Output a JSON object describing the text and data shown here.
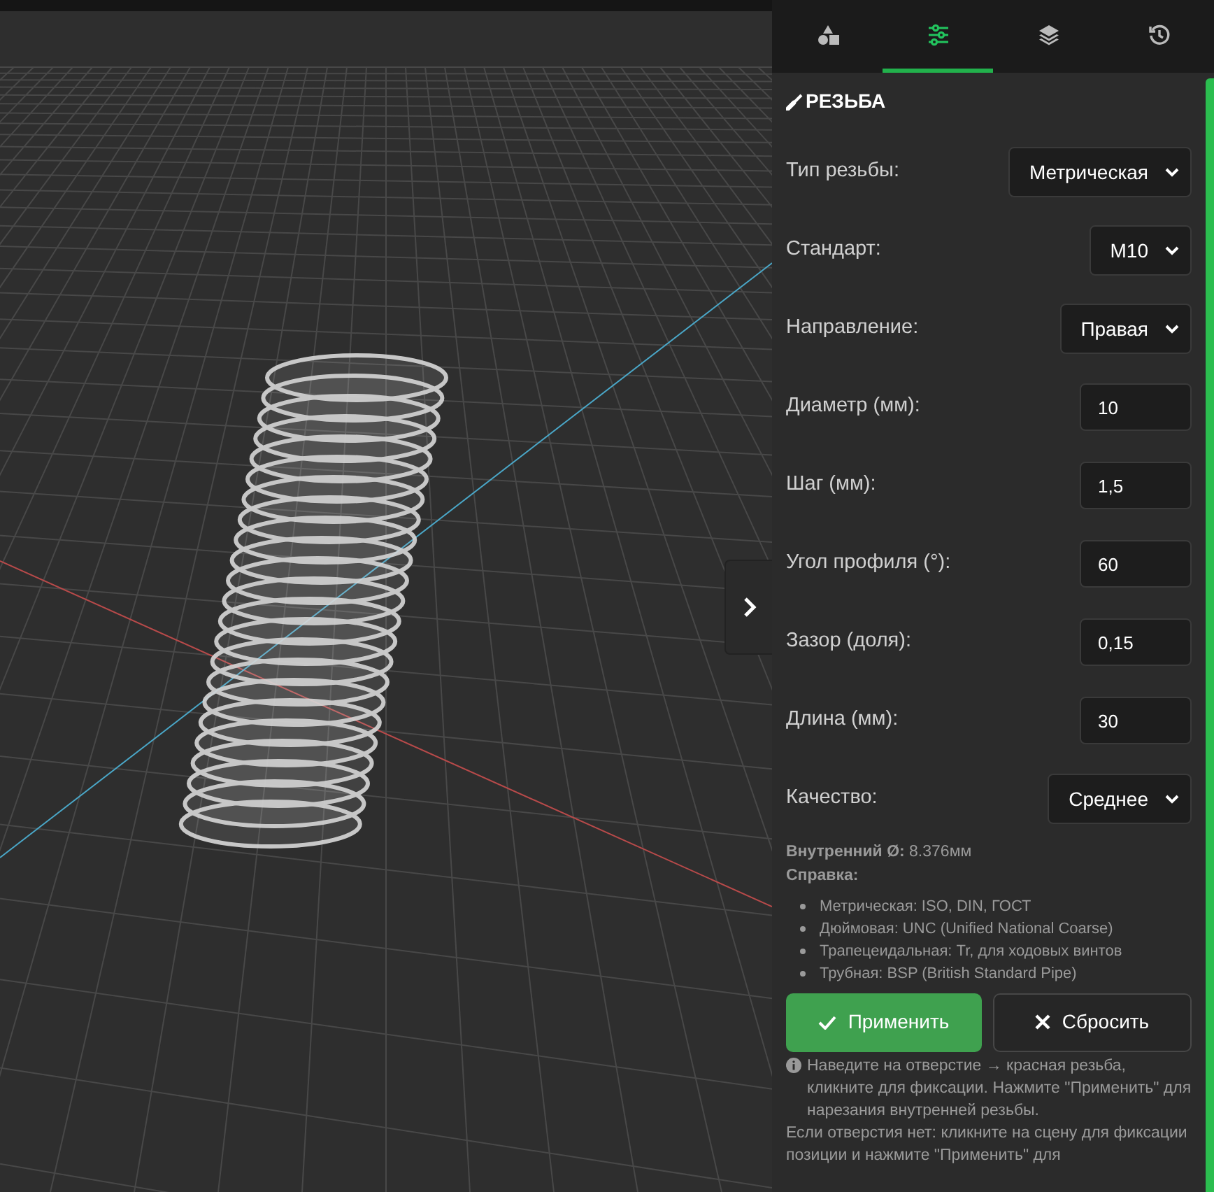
{
  "tabs": [
    {
      "kind": "shapes",
      "selected": false
    },
    {
      "kind": "sliders",
      "selected": true
    },
    {
      "kind": "layers",
      "selected": false
    },
    {
      "kind": "history",
      "selected": false
    }
  ],
  "section_title": "РЕЗЬБА",
  "fields": [
    {
      "label": "Тип резьбы:",
      "kind": "select",
      "value": "Метрическая"
    },
    {
      "label": "Стандарт:",
      "kind": "select",
      "value": "M10"
    },
    {
      "label": "Направление:",
      "kind": "select",
      "value": "Правая"
    },
    {
      "label": "Диаметр (мм):",
      "kind": "input",
      "value": "10"
    },
    {
      "label": "Шаг (мм):",
      "kind": "input",
      "value": "1,5"
    },
    {
      "label": "Угол профиля (°):",
      "kind": "input",
      "value": "60"
    },
    {
      "label": "Зазор (доля):",
      "kind": "input",
      "value": "0,15"
    },
    {
      "label": "Длина (мм):",
      "kind": "input",
      "value": "30"
    },
    {
      "label": "Качество:",
      "kind": "select",
      "value": "Среднее"
    }
  ],
  "inner_diameter": "**Внутренний Ø:** 8.376мм",
  "reference_title": "Справка:",
  "reference_items": [
    "Метрическая: ISO, DIN, ГОСТ",
    "Дюймовая: UNC (Unified National Coarse)",
    "Трапецеидальная: Tr, для ходовых винтов",
    "Трубная: BSP (British Standard Pipe)"
  ],
  "buttons": [
    {
      "kind": "apply",
      "label": "Применить"
    },
    {
      "kind": "reset",
      "label": "Сбросить"
    }
  ],
  "hint_lines": [
    "Наведите на отверстие → красная резьба, кликните для фиксации. Нажмите \"Применить\" для нарезания внутренней резьбы.",
    "Если отверстия нет: кликните на сцену для фиксации позиции и нажмите \"Применить\" для"
  ]
}
